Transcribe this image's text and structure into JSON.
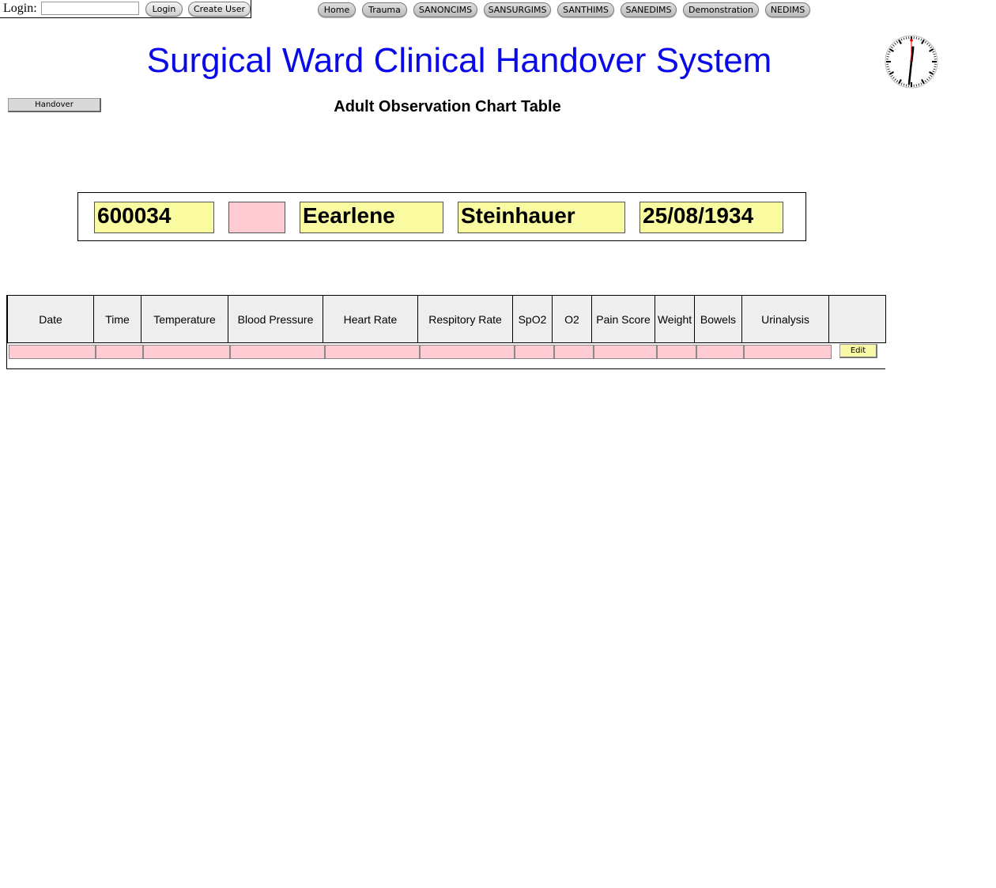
{
  "header": {
    "login_label": "Login:",
    "login_value": "",
    "login_button": "Login",
    "create_user_button": "Create User",
    "nav": [
      "Home",
      "Trauma",
      "SANONCIMS",
      "SANSURGIMS",
      "SANTHIMS",
      "SANEDIMS",
      "Demonstration",
      "NEDIMS"
    ]
  },
  "title": "Surgical Ward Clinical Handover System",
  "subtitle": "Adult Observation Chart Table",
  "handover_button": "Handover",
  "clock": {
    "icon": "analog-clock-icon"
  },
  "patient": {
    "id": "600034",
    "flag": "",
    "first_name": "Eearlene",
    "last_name": "Steinhauer",
    "dob": "25/08/1934"
  },
  "table": {
    "columns": [
      "Date",
      "Time",
      "Temperature",
      "Blood Pressure",
      "Heart Rate",
      "Respitory Rate",
      "SpO2",
      "O2",
      "Pain Score",
      "Weight",
      "Bowels",
      "Urinalysis",
      ""
    ],
    "rows": [
      [
        "",
        "",
        "",
        "",
        "",
        "",
        "",
        "",
        "",
        "",
        "",
        ""
      ]
    ],
    "edit_button": "Edit"
  },
  "colors": {
    "title": "#0a0ae6",
    "field_yellow": "#fafaa0",
    "field_pink": "#ffccd3",
    "header_bg": "#eeeeee"
  }
}
